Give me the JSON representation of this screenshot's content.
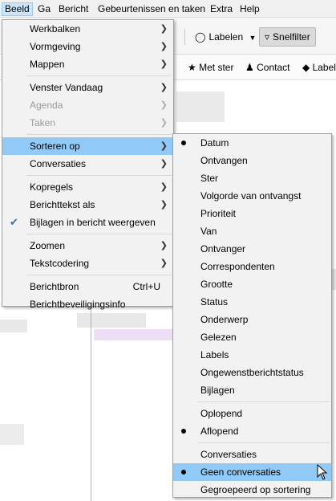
{
  "menubar": {
    "items": [
      {
        "label": "Beeld",
        "active": true
      },
      {
        "label": "Ga"
      },
      {
        "label": "Bericht"
      },
      {
        "label": "Gebeurtenissen en taken"
      },
      {
        "label": "Extra"
      },
      {
        "label": "Help"
      }
    ]
  },
  "toolbar": {
    "tags_label": "Labelen",
    "quickfilter_label": "Snelfilter"
  },
  "quickfilter_bar": {
    "starred_label": "Met ster",
    "contact_label": "Contact",
    "tags_label": "Label"
  },
  "view_menu": {
    "items": [
      {
        "label": "Werkbalken",
        "submenu": true
      },
      {
        "label": "Vormgeving",
        "submenu": true
      },
      {
        "label": "Mappen",
        "submenu": true
      },
      {
        "label": "Venster Vandaag",
        "submenu": true
      },
      {
        "label": "Agenda",
        "submenu": true,
        "disabled": true
      },
      {
        "label": "Taken",
        "submenu": true,
        "disabled": true
      },
      {
        "label": "Sorteren op",
        "submenu": true,
        "highlighted": true
      },
      {
        "label": "Conversaties",
        "submenu": true
      },
      {
        "label": "Kopregels",
        "submenu": true
      },
      {
        "label": "Berichttekst als",
        "submenu": true
      },
      {
        "label": "Bijlagen in bericht weergeven",
        "checked": true
      },
      {
        "label": "Zoomen",
        "submenu": true
      },
      {
        "label": "Tekstcodering",
        "submenu": true
      },
      {
        "label": "Berichtbron",
        "shortcut": "Ctrl+U"
      },
      {
        "label": "Berichtbeveiligingsinfo"
      }
    ]
  },
  "sort_menu": {
    "items": [
      {
        "label": "Datum",
        "selected": true
      },
      {
        "label": "Ontvangen"
      },
      {
        "label": "Ster"
      },
      {
        "label": "Volgorde van ontvangst"
      },
      {
        "label": "Prioriteit"
      },
      {
        "label": "Van"
      },
      {
        "label": "Ontvanger"
      },
      {
        "label": "Correspondenten"
      },
      {
        "label": "Grootte"
      },
      {
        "label": "Status"
      },
      {
        "label": "Onderwerp"
      },
      {
        "label": "Gelezen"
      },
      {
        "label": "Labels"
      },
      {
        "label": "Ongewenstberichtstatus"
      },
      {
        "label": "Bijlagen"
      },
      {
        "label": "Oplopend"
      },
      {
        "label": "Aflopend",
        "selected": true
      },
      {
        "label": "Conversaties"
      },
      {
        "label": "Geen conversaties",
        "selected": true,
        "highlighted": true
      },
      {
        "label": "Gegroepeerd op sortering"
      }
    ]
  },
  "icons": {
    "submenu_arrow": "chevron-right-icon",
    "check": "check-icon",
    "radio": "radio-dot-icon"
  },
  "colors": {
    "highlight": "#91c9f7",
    "menu_bg": "#f2f2f2",
    "menubar_active": "#cce4f7"
  }
}
